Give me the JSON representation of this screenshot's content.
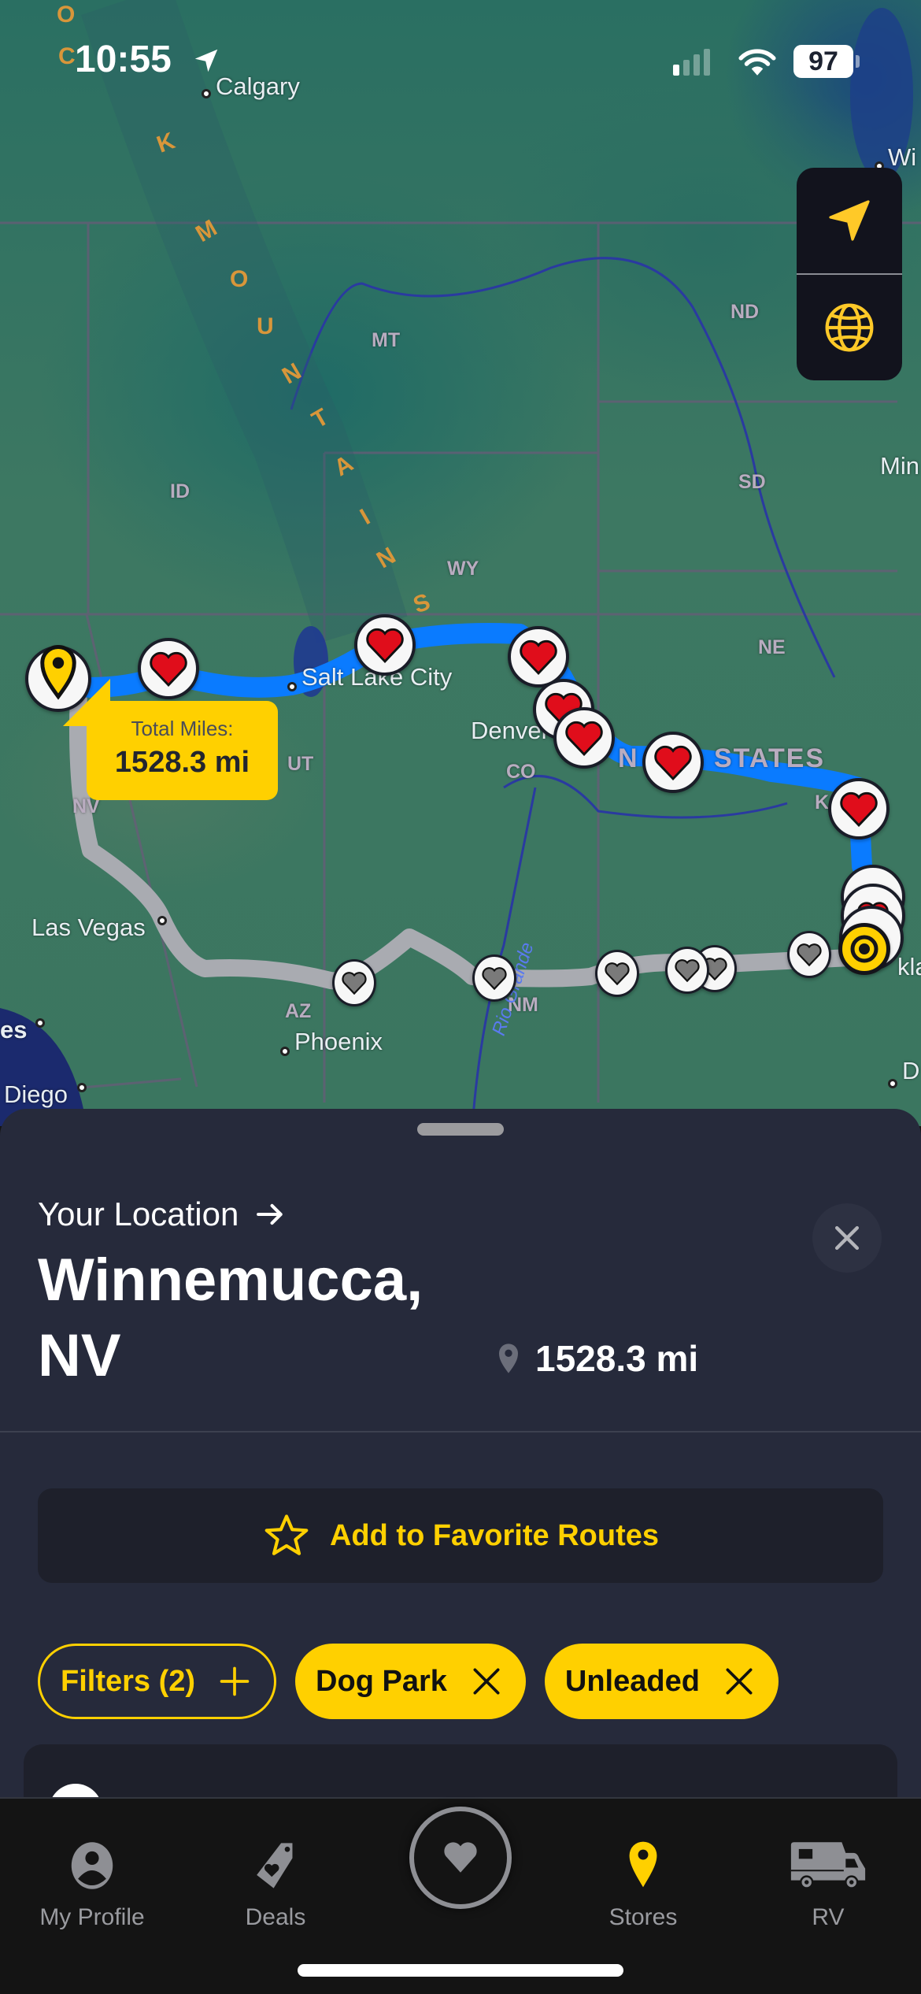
{
  "status_bar": {
    "time": "10:55",
    "battery": "97",
    "location_services": true,
    "signal_bars_active": 1,
    "signal_bars_total": 4,
    "wifi": true
  },
  "map": {
    "cities": [
      "Calgary",
      "Salt Lake City",
      "Denver",
      "Las Vegas",
      "Phoenix",
      "Diego",
      "es",
      "Wi",
      "Min",
      "kla",
      "D"
    ],
    "states": [
      "MT",
      "ID",
      "WY",
      "ND",
      "SD",
      "NE",
      "UT",
      "CO",
      "NV",
      "AZ",
      "NM",
      "K"
    ],
    "country_label": "STATES",
    "country_label_prefix": "N",
    "mountain_range": "ROCKY MOUNTAINS",
    "river": "Rio Grande",
    "controls": [
      {
        "name": "recenter",
        "icon": "navigation-arrow-icon"
      },
      {
        "name": "map-style",
        "icon": "globe-icon"
      }
    ],
    "route_total": {
      "label": "Total Miles:",
      "value": "1528.3 mi"
    },
    "colors": {
      "active_route": "#0a7bff",
      "alt_route": "#a9abb1",
      "accent": "#ffd000",
      "favorite_heart": "#e00d1b"
    }
  },
  "sheet": {
    "origin_label": "Your Location",
    "destination": "Winnemucca, NV",
    "destination_line1": "Winnemucca,",
    "destination_line2": "NV",
    "distance": "1528.3 mi",
    "favorite_button": "Add to Favorite Routes",
    "filters": {
      "button_label": "Filters (2)",
      "active": [
        "Dog Park",
        "Unleaded"
      ]
    }
  },
  "tab_bar": {
    "tabs": [
      {
        "label": "My Profile",
        "icon": "profile-icon",
        "active": false
      },
      {
        "label": "Deals",
        "icon": "deals-tag-icon",
        "active": false
      },
      {
        "label": "",
        "icon": "heart-circle-icon",
        "active": false
      },
      {
        "label": "Stores",
        "icon": "map-pin-icon",
        "active": true
      },
      {
        "label": "RV",
        "icon": "rv-icon",
        "active": false
      }
    ]
  }
}
